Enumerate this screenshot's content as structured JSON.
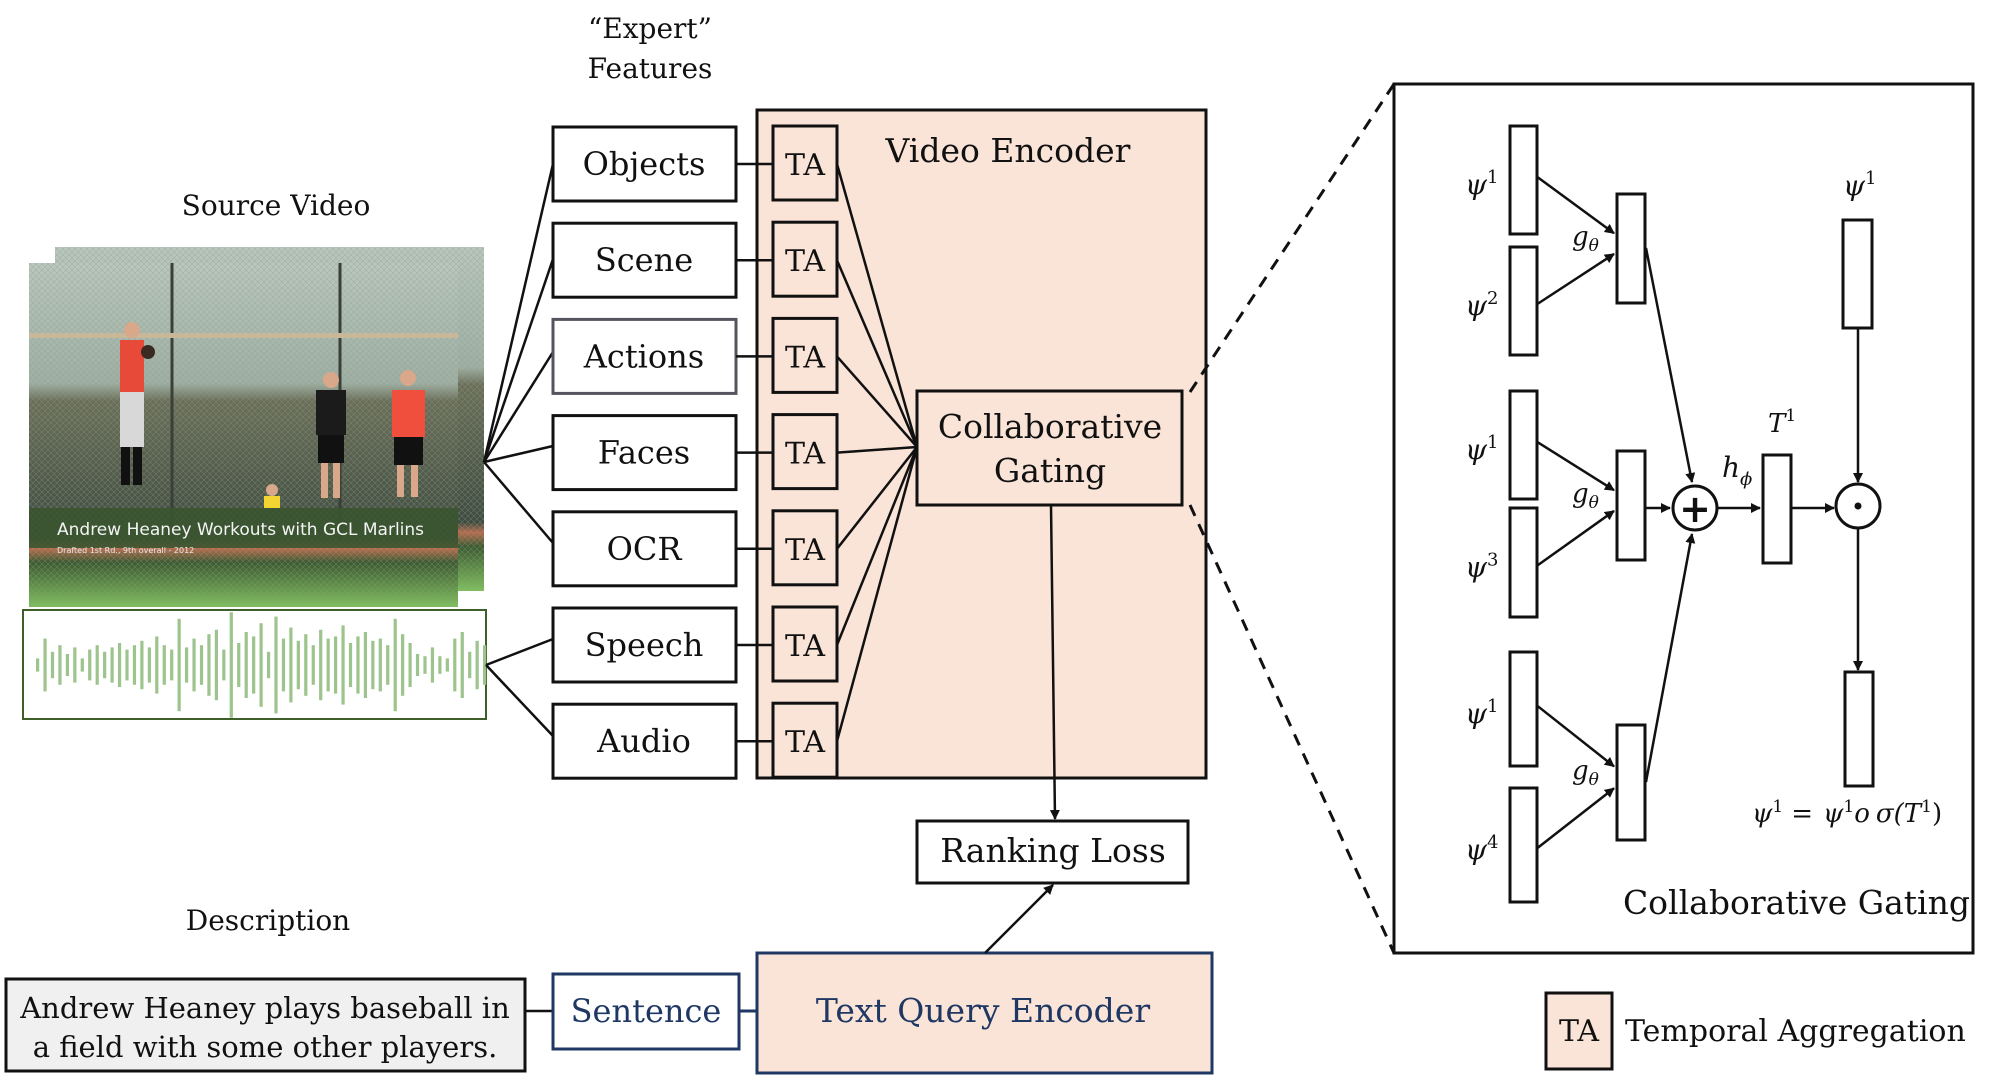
{
  "source_video": {
    "title": "Source Video",
    "frame_caption": "Andrew Heaney Workouts with GCL Marlins",
    "frame_subcaption": "Drafted 1st Rd., 9th overall - 2012"
  },
  "experts": {
    "title_line1": "“Expert”",
    "title_line2": "Features",
    "items": [
      {
        "label": "Objects"
      },
      {
        "label": "Scene"
      },
      {
        "label": "Actions"
      },
      {
        "label": "Faces"
      },
      {
        "label": "OCR"
      },
      {
        "label": "Speech"
      },
      {
        "label": "Audio"
      }
    ],
    "ta_label": "TA"
  },
  "video_encoder": {
    "title": "Video Encoder",
    "cg_line1": "Collaborative",
    "cg_line2": "Gating"
  },
  "ranking_loss": "Ranking Loss",
  "description": {
    "title": "Description",
    "line1": "Andrew Heaney plays baseball in",
    "line2": "a field with some other players."
  },
  "sentence": "Sentence",
  "text_query_encoder": "Text Query Encoder",
  "cg_panel": {
    "title": "Collaborative Gating",
    "psi": "ψ",
    "g_theta": "g",
    "g_sub": "θ",
    "h_phi": "h",
    "h_sub": "ϕ",
    "t_label": "T",
    "sup1": "1",
    "sup2": "2",
    "sup3": "3",
    "sup4": "4",
    "plus_symbol": "+",
    "dot_symbol": "·",
    "formula_lhs": "ψ",
    "formula_eq": "=",
    "formula_rhs_psi": "ψ",
    "formula_o": "o",
    "formula_sigma": "σ(",
    "formula_T": "T",
    "formula_close": ")"
  },
  "legend": {
    "box_label": "TA",
    "text": "Temporal Aggregation"
  },
  "colors": {
    "encoder_fill": "#fae4d8",
    "navy": "#1f3763",
    "description_fill": "#f0f0f0",
    "waveform": "#9cc48c",
    "waveform_border": "#3f5f2a"
  }
}
